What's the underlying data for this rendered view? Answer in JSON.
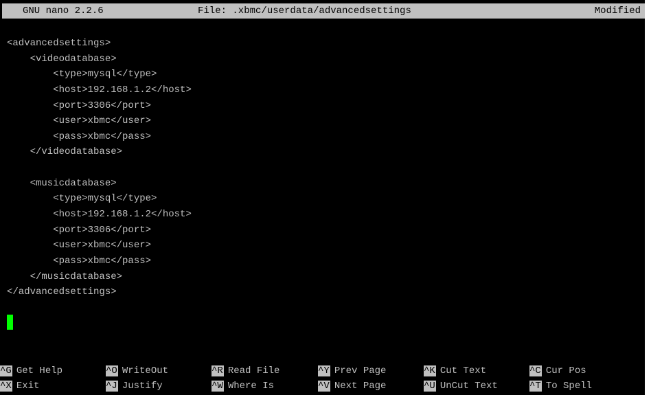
{
  "titlebar": {
    "app": "GNU nano 2.2.6",
    "file": "File: .xbmc/userdata/advancedsettings",
    "status": "Modified"
  },
  "editor": {
    "lines": [
      "<advancedsettings>",
      "    <videodatabase>",
      "        <type>mysql</type>",
      "        <host>192.168.1.2</host>",
      "        <port>3306</port>",
      "        <user>xbmc</user>",
      "        <pass>xbmc</pass>",
      "    </videodatabase>",
      "",
      "    <musicdatabase>",
      "        <type>mysql</type>",
      "        <host>192.168.1.2</host>",
      "        <port>3306</port>",
      "        <user>xbmc</user>",
      "        <pass>xbmc</pass>",
      "    </musicdatabase>",
      "</advancedsettings>"
    ]
  },
  "shortcuts": {
    "row1": [
      {
        "key": "^G",
        "label": "Get Help"
      },
      {
        "key": "^O",
        "label": "WriteOut"
      },
      {
        "key": "^R",
        "label": "Read File"
      },
      {
        "key": "^Y",
        "label": "Prev Page"
      },
      {
        "key": "^K",
        "label": "Cut Text"
      },
      {
        "key": "^C",
        "label": "Cur Pos"
      }
    ],
    "row2": [
      {
        "key": "^X",
        "label": "Exit"
      },
      {
        "key": "^J",
        "label": "Justify"
      },
      {
        "key": "^W",
        "label": "Where Is"
      },
      {
        "key": "^V",
        "label": "Next Page"
      },
      {
        "key": "^U",
        "label": "UnCut Text"
      },
      {
        "key": "^T",
        "label": "To Spell"
      }
    ]
  },
  "colors": {
    "background": "#000000",
    "text": "#c0c0c0",
    "inverse_bg": "#c0c0c0",
    "cursor": "#00ff00"
  }
}
